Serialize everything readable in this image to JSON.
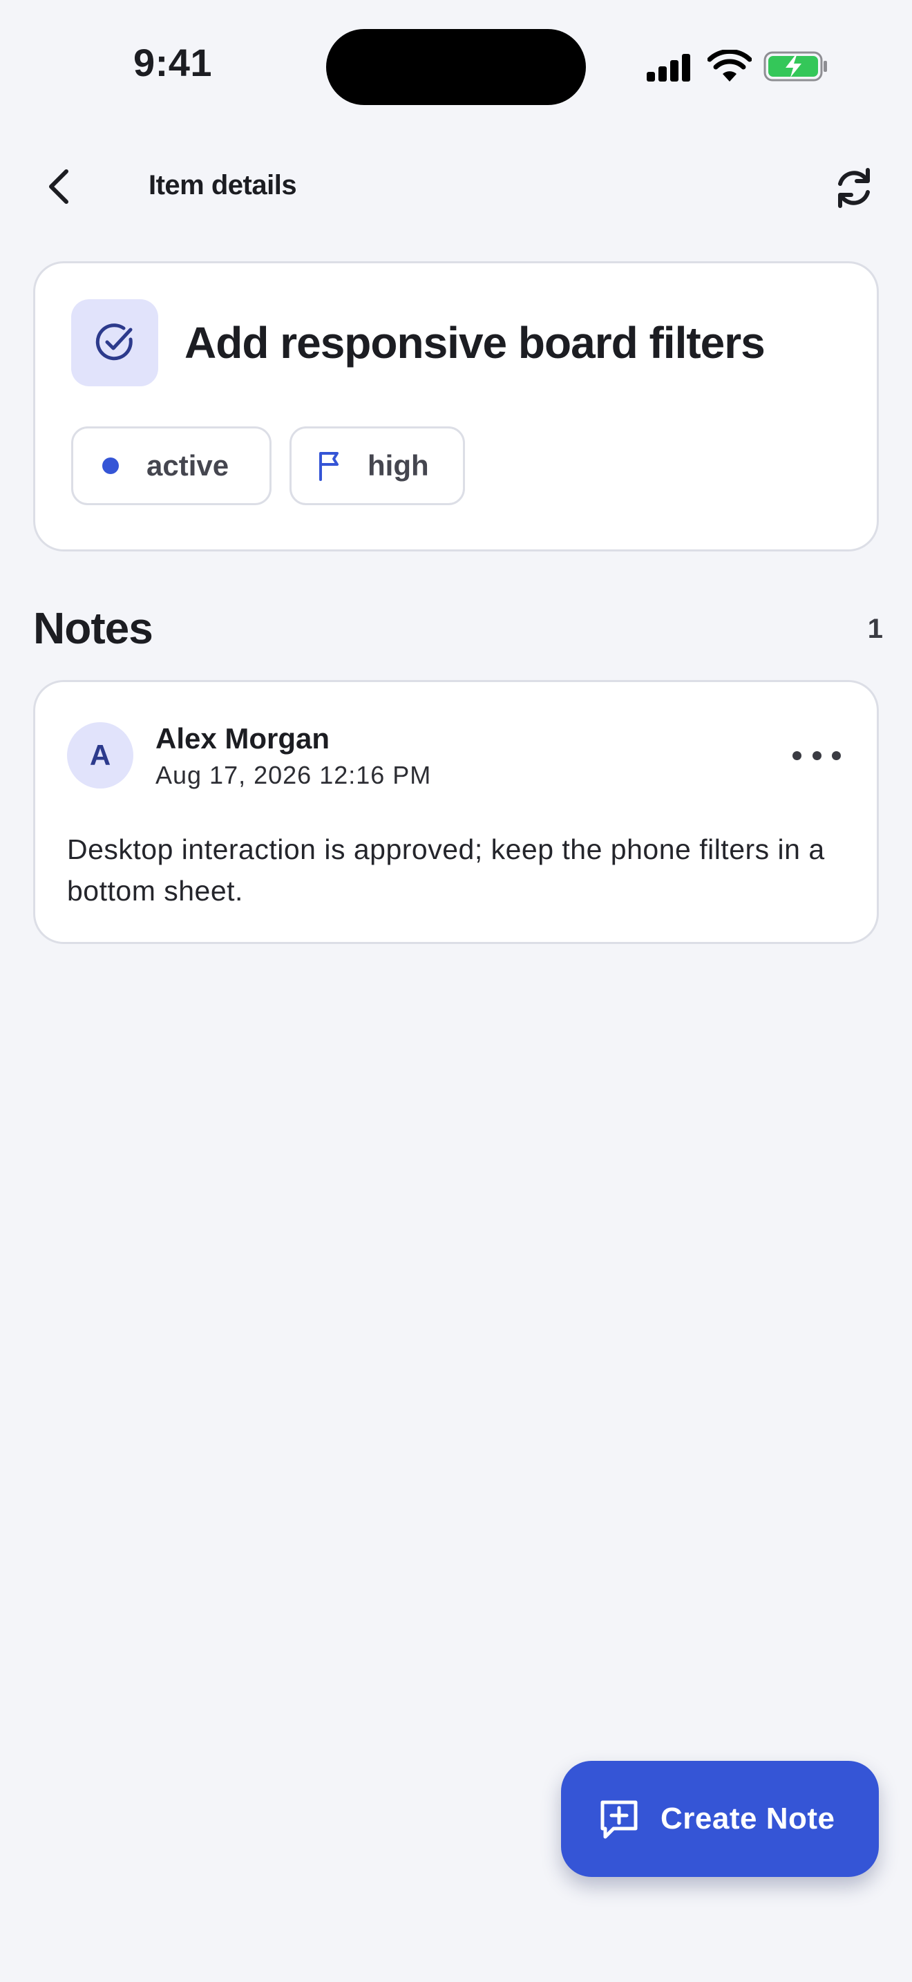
{
  "status_bar": {
    "time": "9:41",
    "icons": [
      "signal-icon",
      "wifi-icon",
      "battery-charging-icon"
    ],
    "battery_color": "#34c759"
  },
  "nav": {
    "title": "Item details",
    "back_icon": "chevron-left-icon",
    "refresh_icon": "refresh-icon"
  },
  "item": {
    "icon": "check-circle-icon",
    "title": "Add responsive board filters",
    "status": "active",
    "priority": "high",
    "accent_color": "#3555d6"
  },
  "notes": {
    "heading": "Notes",
    "count": "1",
    "items": [
      {
        "avatar_initial": "A",
        "author": "Alex Morgan",
        "date": "Aug 17, 2026 12:16 PM",
        "body": "Desktop interaction is approved; keep the phone filters in a bottom sheet."
      }
    ]
  },
  "fab": {
    "label": "Create Note",
    "icon": "add-note-icon"
  }
}
